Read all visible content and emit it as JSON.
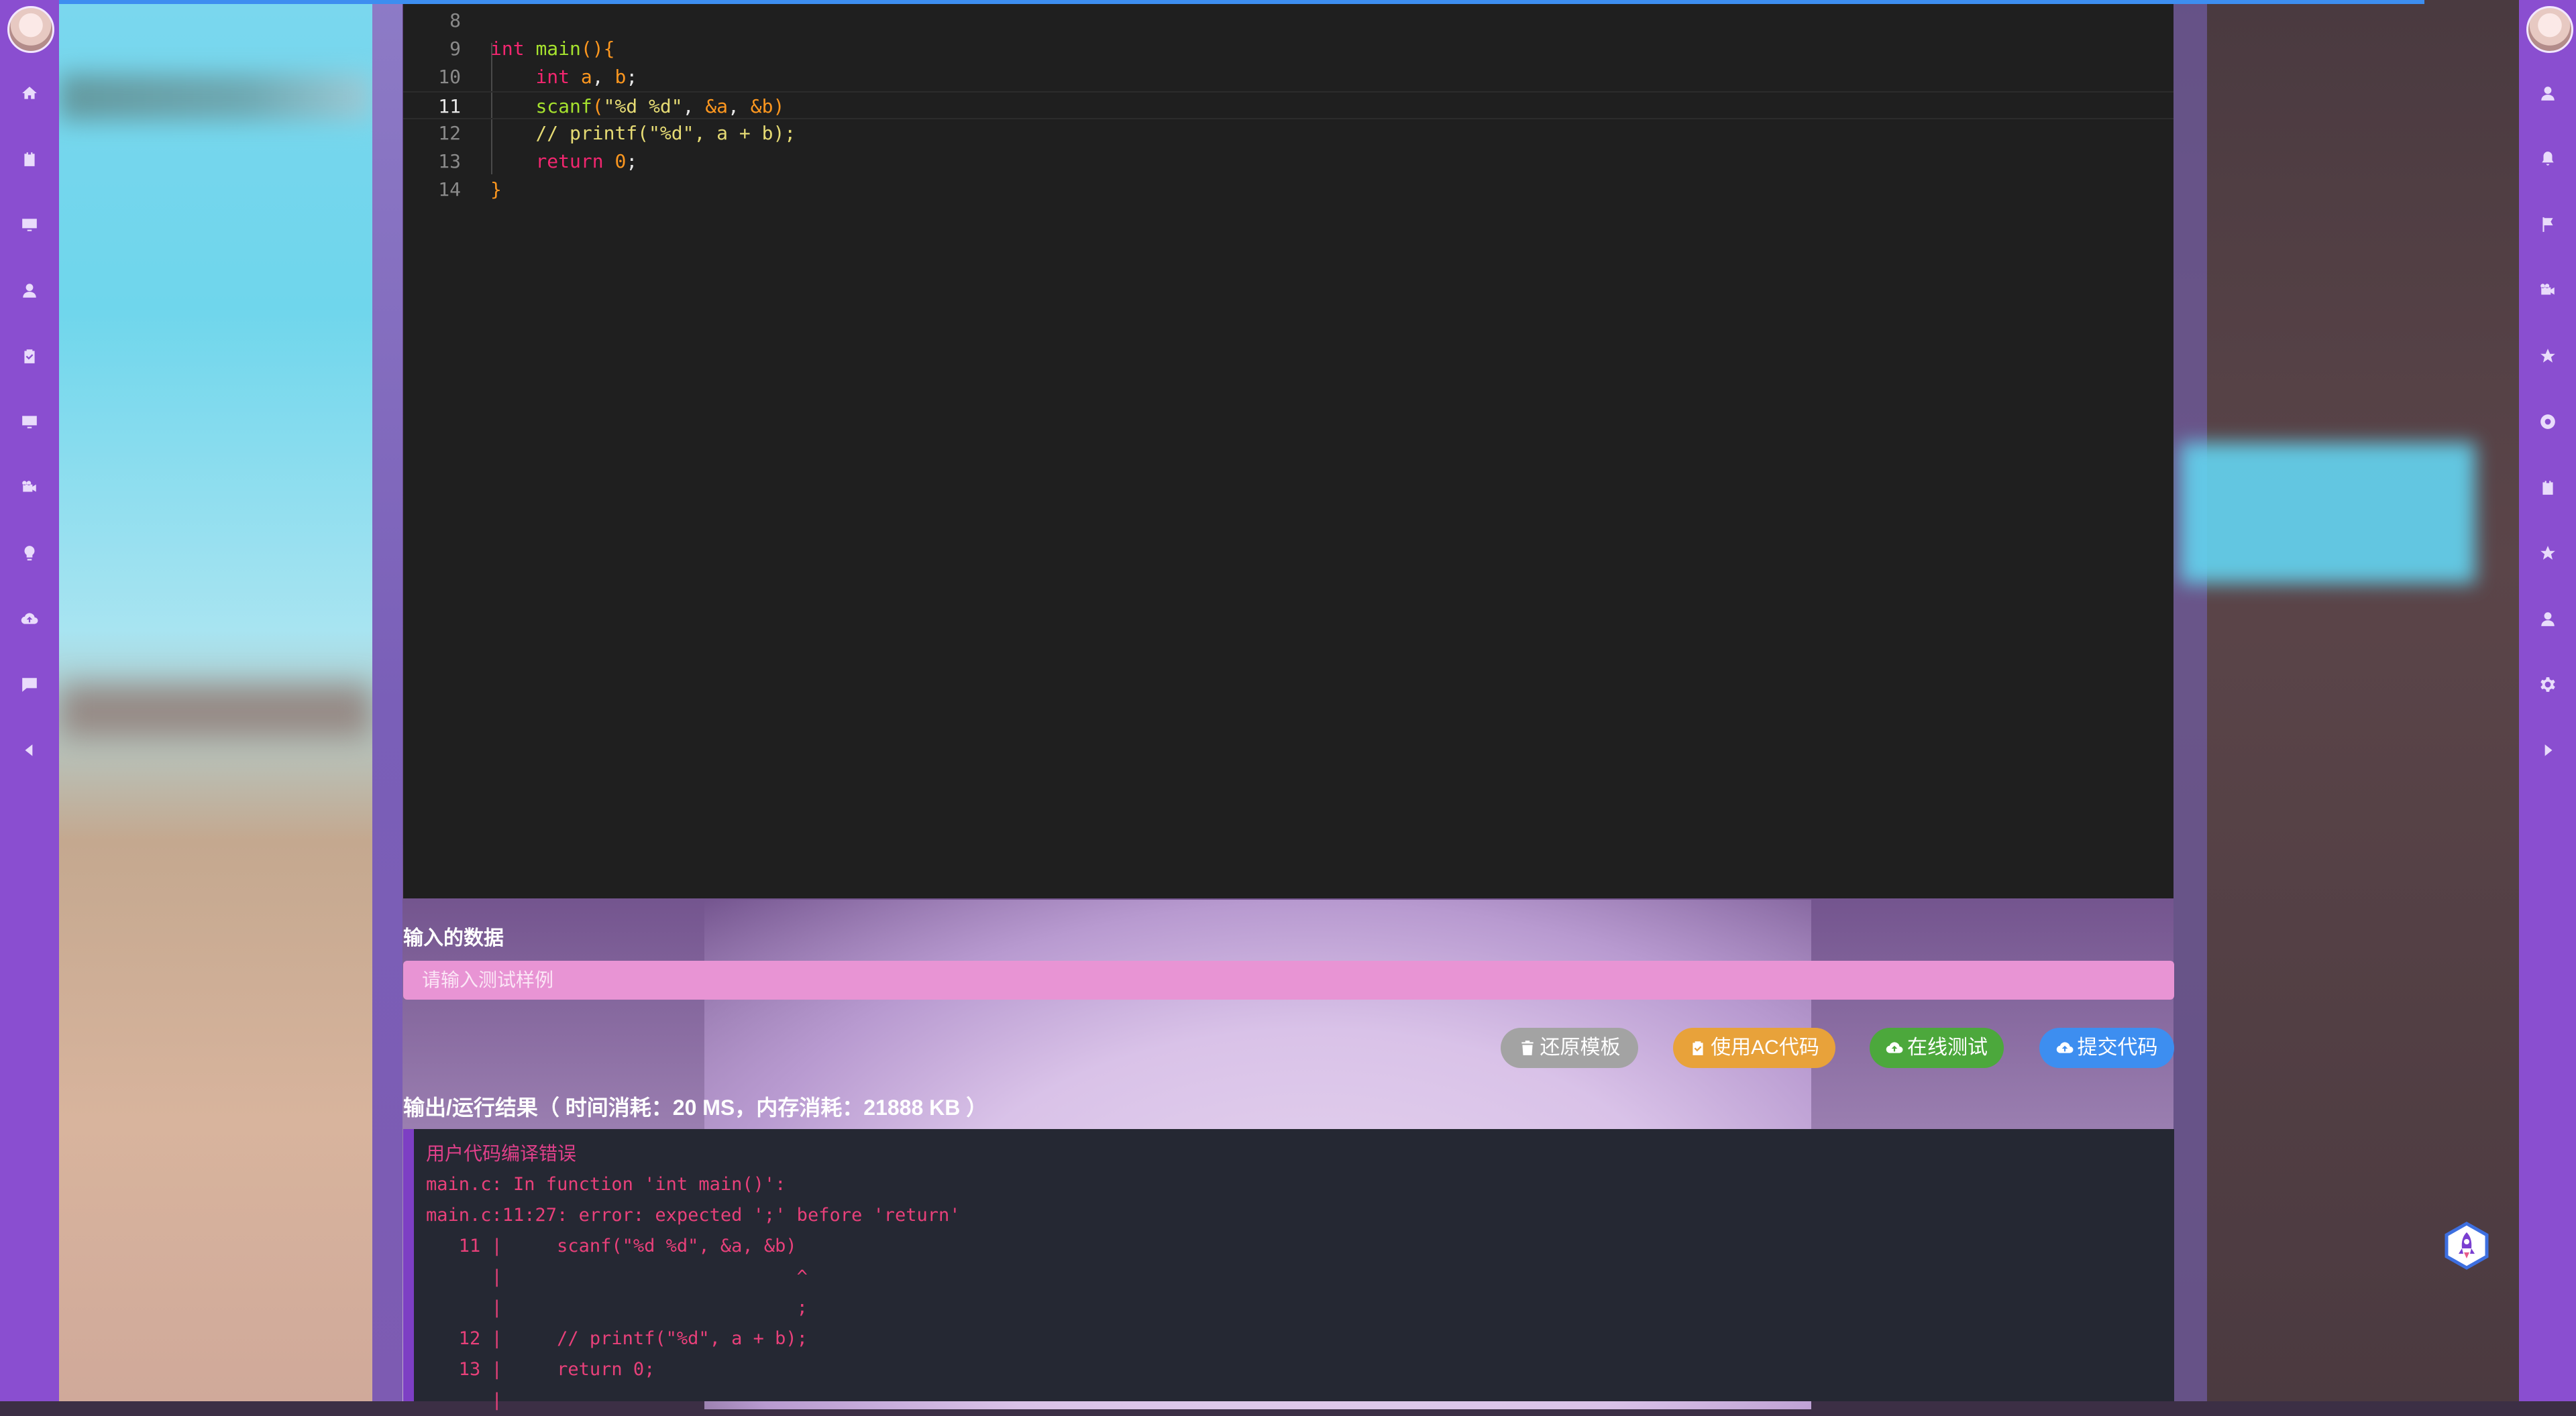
{
  "editor": {
    "lines": [
      {
        "no": "8",
        "parts": []
      },
      {
        "no": "9",
        "parts": [
          {
            "c": "kw",
            "t": "int "
          },
          {
            "c": "fn",
            "t": "main"
          },
          {
            "c": "var",
            "t": "(){"
          }
        ]
      },
      {
        "no": "10",
        "parts": [
          {
            "c": "pl",
            "t": "    "
          },
          {
            "c": "kw",
            "t": "int "
          },
          {
            "c": "var",
            "t": "a"
          },
          {
            "c": "pl",
            "t": ", "
          },
          {
            "c": "var",
            "t": "b"
          },
          {
            "c": "pl",
            "t": ";"
          }
        ]
      },
      {
        "no": "11",
        "active": true,
        "parts": [
          {
            "c": "pl",
            "t": "    "
          },
          {
            "c": "fn",
            "t": "scanf"
          },
          {
            "c": "var",
            "t": "("
          },
          {
            "c": "str",
            "t": "\"%d %d\""
          },
          {
            "c": "pl",
            "t": ", "
          },
          {
            "c": "var",
            "t": "&a"
          },
          {
            "c": "pl",
            "t": ", "
          },
          {
            "c": "var",
            "t": "&b"
          },
          {
            "c": "var",
            "t": ")"
          }
        ]
      },
      {
        "no": "12",
        "parts": [
          {
            "c": "pl",
            "t": "    "
          },
          {
            "c": "cm",
            "t": "// printf(\"%d\", a + b);"
          }
        ]
      },
      {
        "no": "13",
        "parts": [
          {
            "c": "pl",
            "t": "    "
          },
          {
            "c": "kw",
            "t": "return "
          },
          {
            "c": "var",
            "t": "0"
          },
          {
            "c": "pl",
            "t": ";"
          }
        ]
      },
      {
        "no": "14",
        "parts": [
          {
            "c": "var",
            "t": "}"
          }
        ]
      }
    ]
  },
  "input": {
    "label": "输入的数据",
    "placeholder": "请输入测试样例"
  },
  "buttons": {
    "restore": "还原模板",
    "use_ac": "使用AC代码",
    "online_test": "在线测试",
    "submit": "提交代码"
  },
  "output": {
    "label": "输出/运行结果（ 时间消耗：20 MS，内存消耗：21888 KB ）",
    "lines": [
      "用户代码编译错误",
      "main.c: In function 'int main()':",
      "main.c:11:27: error: expected ';' before 'return'",
      "   11 |     scanf(\"%d %d\", &a, &b)",
      "      |                           ^",
      "      |                           ;",
      "   12 |     // printf(\"%d\", a + b);",
      "   13 |     return 0;",
      "      |"
    ]
  },
  "icons": {
    "left": [
      "home-icon",
      "clipboard-icon",
      "monitor-icon",
      "user-icon",
      "clipboard-check-icon",
      "desktop-icon",
      "camera-icon",
      "lightbulb-icon",
      "cloud-upload-icon",
      "comment-icon",
      "caret-left-icon"
    ],
    "right": [
      "user-icon",
      "bell-icon",
      "flag-icon",
      "camera-icon",
      "star-icon",
      "lifebuoy-icon",
      "clipboard-icon",
      "star-icon",
      "user-icon",
      "gear-icon",
      "caret-right-icon"
    ]
  },
  "colors": {
    "sidebar": "#8a4ed0",
    "editor_bg": "#1f1f1f",
    "input_bg": "#e894d4",
    "btn_gray": "#a3a3a3",
    "btn_orange": "#e8a23a",
    "btn_green": "#4ca83c",
    "btn_blue": "#3d8ef0",
    "error_text": "#e8407a"
  }
}
